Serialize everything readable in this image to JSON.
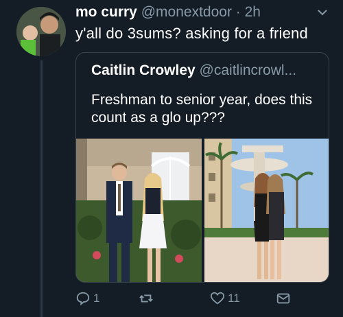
{
  "tweet": {
    "display_name": "mo curry",
    "handle": "@monextdoor",
    "separator": "·",
    "time": "2h",
    "text": "y'all do 3sums? asking for a friend"
  },
  "quoted": {
    "display_name": "Caitlin Crowley",
    "handle": "@caitlincrowl...",
    "text": "Freshman to senior year, does this count as a glo up???"
  },
  "actions": {
    "reply_count": "1",
    "retweet_count": "",
    "like_count": "11"
  },
  "colors": {
    "background": "#141d26",
    "secondary_text": "#8899a6",
    "border": "#38444d"
  },
  "icons": [
    "chevron-down-icon",
    "reply-icon",
    "retweet-icon",
    "like-icon",
    "direct-message-icon"
  ]
}
